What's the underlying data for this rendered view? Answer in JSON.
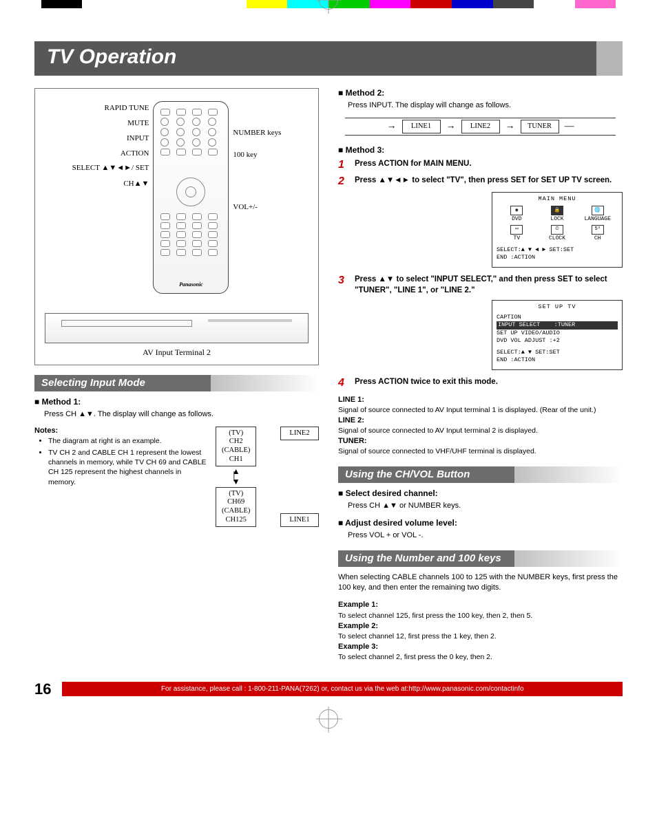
{
  "page": {
    "title": "TV Operation",
    "number": "16",
    "footer": "For assistance, please call : 1-800-211-PANA(7262) or, contact us via the web at:http://www.panasonic.com/contactinfo"
  },
  "remote": {
    "labels_left": [
      "RAPID TUNE",
      "MUTE",
      "INPUT",
      "ACTION",
      "SELECT ▲▼◄►/ SET",
      "CH▲▼"
    ],
    "labels_right": [
      "NUMBER keys",
      "100 key",
      "VOL+/-"
    ],
    "brand": "Panasonic",
    "caption": "AV Input Terminal 2"
  },
  "sec1": {
    "title": "Selecting Input Mode",
    "m1_title": "Method 1:",
    "m1_body": "Press CH ▲▼. The display will change as follows.",
    "notes_title": "Notes:",
    "notes": [
      "The diagram at right is an example.",
      "TV CH 2 and CABLE CH 1 represent the lowest channels in memory, while TV CH 69 and CABLE CH 125 represent the highest channels in memory."
    ],
    "flow": {
      "a": "(TV)\nCH2\n(CABLE)\nCH1",
      "b": "(TV)\nCH69\n(CABLE)\nCH125",
      "c": "LINE2",
      "d": "LINE1"
    }
  },
  "sec_m2": {
    "title": "Method 2:",
    "body": "Press INPUT. The display will change as follows.",
    "flow": [
      "LINE1",
      "LINE2",
      "TUNER"
    ]
  },
  "sec_m3": {
    "title": "Method 3:",
    "steps": [
      {
        "n": "1",
        "t": "Press ACTION for MAIN MENU."
      },
      {
        "n": "2",
        "t": "Press ▲▼◄► to select \"TV\", then press SET for SET UP TV screen."
      },
      {
        "n": "3",
        "t": "Press ▲▼ to select \"INPUT SELECT,\" and then press SET to select \"TUNER\", \"LINE 1\", or \"LINE 2.\""
      },
      {
        "n": "4",
        "t": "Press ACTION twice to exit this mode."
      }
    ],
    "osd1": {
      "title": "MAIN MENU",
      "row1": [
        "DVD",
        "LOCK",
        "LANGUAGE"
      ],
      "row2": [
        "TV",
        "CLOCK",
        "CH"
      ],
      "foot1": "SELECT:▲ ▼ ◄ ►   SET:SET",
      "foot2": "END   :ACTION"
    },
    "osd2": {
      "title": "SET UP TV",
      "r1": "CAPTION",
      "r2l": "INPUT SELECT",
      "r2r": ":TUNER",
      "r3": "SET UP VIDEO/AUDIO",
      "r4": "DVD VOL ADJUST :+2",
      "foot1": "SELECT:▲ ▼        SET:SET",
      "foot2": "END   :ACTION"
    },
    "defs": {
      "l1t": "LINE 1:",
      "l1": "Signal of source connected to AV Input terminal 1 is displayed. (Rear of the unit.)",
      "l2t": "LINE 2:",
      "l2": "Signal of source connected to AV Input terminal 2 is displayed.",
      "l3t": "TUNER:",
      "l3": "Signal of source connected to VHF/UHF terminal is displayed."
    }
  },
  "sec2": {
    "title": "Using the CH/VOL Button",
    "a_t": "Select desired channel:",
    "a_b": "Press CH ▲▼ or NUMBER keys.",
    "b_t": "Adjust desired volume level:",
    "b_b": "Press VOL + or VOL -."
  },
  "sec3": {
    "title": "Using the Number and 100 keys",
    "intro": "When selecting CABLE channels 100 to 125 with the NUMBER keys, first press the 100 key, and then enter the remaining two digits.",
    "e1t": "Example 1:",
    "e1": "To select channel 125, first press the 100 key, then 2, then 5.",
    "e2t": "Example 2:",
    "e2": "To select channel 12, first press the 1 key, then 2.",
    "e3t": "Example 3:",
    "e3": "To select channel 2, first press the 0 key, then 2."
  }
}
